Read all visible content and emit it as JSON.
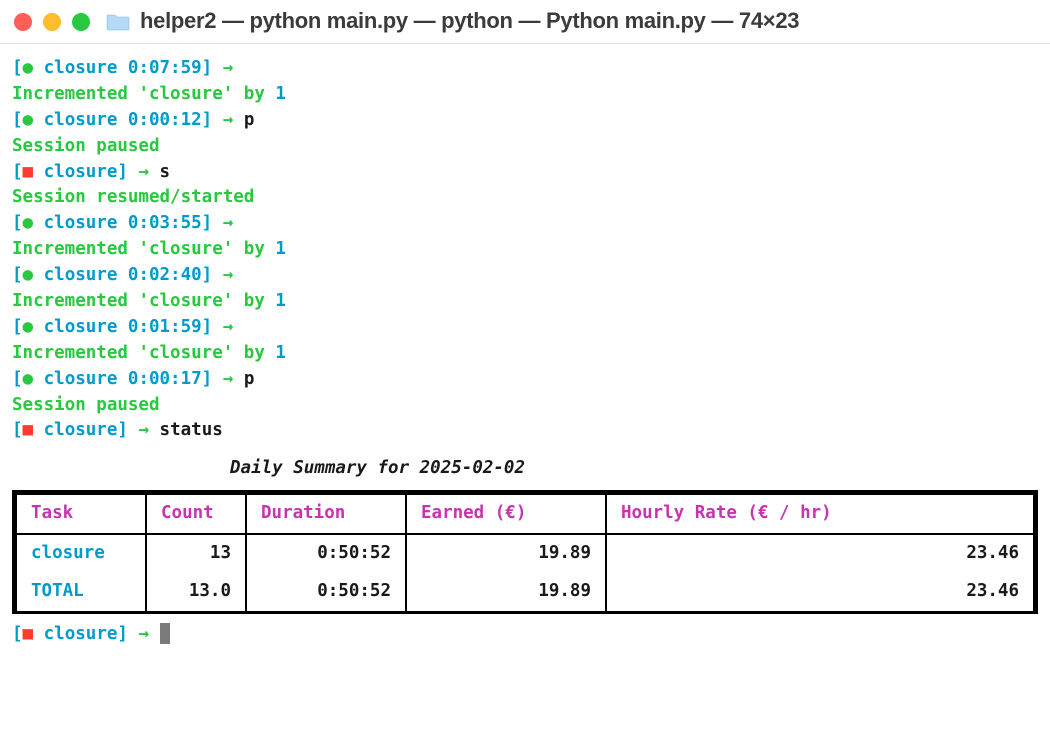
{
  "window": {
    "title": "helper2 — python main.py — python — Python main.py — 74×23"
  },
  "lines": [
    {
      "type": "prompt_green",
      "name": "closure",
      "time": "0:07:59",
      "input": ""
    },
    {
      "type": "increment",
      "text1": "Incremented ",
      "q": "'closure'",
      "text2": " by ",
      "n": "1"
    },
    {
      "type": "prompt_green",
      "name": "closure",
      "time": "0:00:12",
      "input": "p"
    },
    {
      "type": "msg",
      "text": "Session paused"
    },
    {
      "type": "prompt_red",
      "name": "closure",
      "input": "s"
    },
    {
      "type": "msg",
      "text": "Session resumed/started"
    },
    {
      "type": "prompt_green",
      "name": "closure",
      "time": "0:03:55",
      "input": ""
    },
    {
      "type": "increment",
      "text1": "Incremented ",
      "q": "'closure'",
      "text2": " by ",
      "n": "1"
    },
    {
      "type": "prompt_green",
      "name": "closure",
      "time": "0:02:40",
      "input": ""
    },
    {
      "type": "increment",
      "text1": "Incremented ",
      "q": "'closure'",
      "text2": " by ",
      "n": "1"
    },
    {
      "type": "prompt_green",
      "name": "closure",
      "time": "0:01:59",
      "input": ""
    },
    {
      "type": "increment",
      "text1": "Incremented ",
      "q": "'closure'",
      "text2": " by ",
      "n": "1"
    },
    {
      "type": "prompt_green",
      "name": "closure",
      "time": "0:00:17",
      "input": "p"
    },
    {
      "type": "msg",
      "text": "Session paused"
    },
    {
      "type": "prompt_red",
      "name": "closure",
      "input": "status"
    }
  ],
  "summary": {
    "title": "Daily Summary for 2025-02-02",
    "headers": {
      "task": "Task",
      "count": "Count",
      "duration": "Duration",
      "earned": "Earned (€)",
      "rate": "Hourly Rate (€ / hr)"
    },
    "rows": [
      {
        "task": "closure",
        "task_style": "blue",
        "count": "13",
        "duration": "0:50:52",
        "earned": "19.89",
        "rate": "23.46",
        "bold": false
      },
      {
        "task": "TOTAL",
        "task_style": "blue bold",
        "count": "13.0",
        "duration": "0:50:52",
        "earned": "19.89",
        "rate": "23.46",
        "bold": true
      }
    ]
  },
  "final_prompt": {
    "name": "closure"
  }
}
